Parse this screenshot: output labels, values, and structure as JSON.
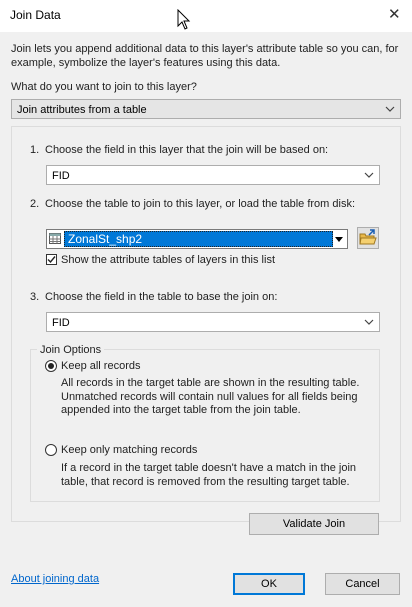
{
  "window": {
    "title": "Join Data",
    "close_glyph": "✕"
  },
  "intro_text": "Join lets you append additional data to this layer's attribute table so you can, for example, symbolize the layer's features using this data.",
  "question_label": "What do you want to join to this layer?",
  "join_type": {
    "selected": "Join attributes from a table"
  },
  "steps": {
    "step1": {
      "number": "1.",
      "label": "Choose the field in this layer that the join will be based on:",
      "field_value": "FID"
    },
    "step2": {
      "number": "2.",
      "label": "Choose the table to join to this layer, or load the table from disk:",
      "table_value": "ZonalSt_shp2",
      "show_layers_checkbox": {
        "label": "Show the attribute tables of layers in this list",
        "checked": true
      }
    },
    "step3": {
      "number": "3.",
      "label": "Choose the field in the table to base the join on:",
      "field_value": "FID"
    }
  },
  "join_options": {
    "legend": "Join Options",
    "keep_all": {
      "label": "Keep all records",
      "selected": true,
      "description": "All records in the target table are shown in the resulting table. Unmatched records will contain null values for all fields being appended into the target table from the join table."
    },
    "keep_matching": {
      "label": "Keep only matching records",
      "selected": false,
      "description": "If a record in the target table doesn't have a match in the join table, that record is removed from the resulting target table."
    }
  },
  "buttons": {
    "validate": "Validate Join",
    "ok": "OK",
    "cancel": "Cancel"
  },
  "help_link": "About joining data",
  "colors": {
    "accent": "#0078d7",
    "link": "#0066cc",
    "dialog_bg": "#f0f0f0"
  },
  "icons": [
    "close-icon",
    "cursor-icon",
    "dropdown-arrow-icon",
    "table-icon",
    "open-folder-icon",
    "checkmark-icon"
  ]
}
